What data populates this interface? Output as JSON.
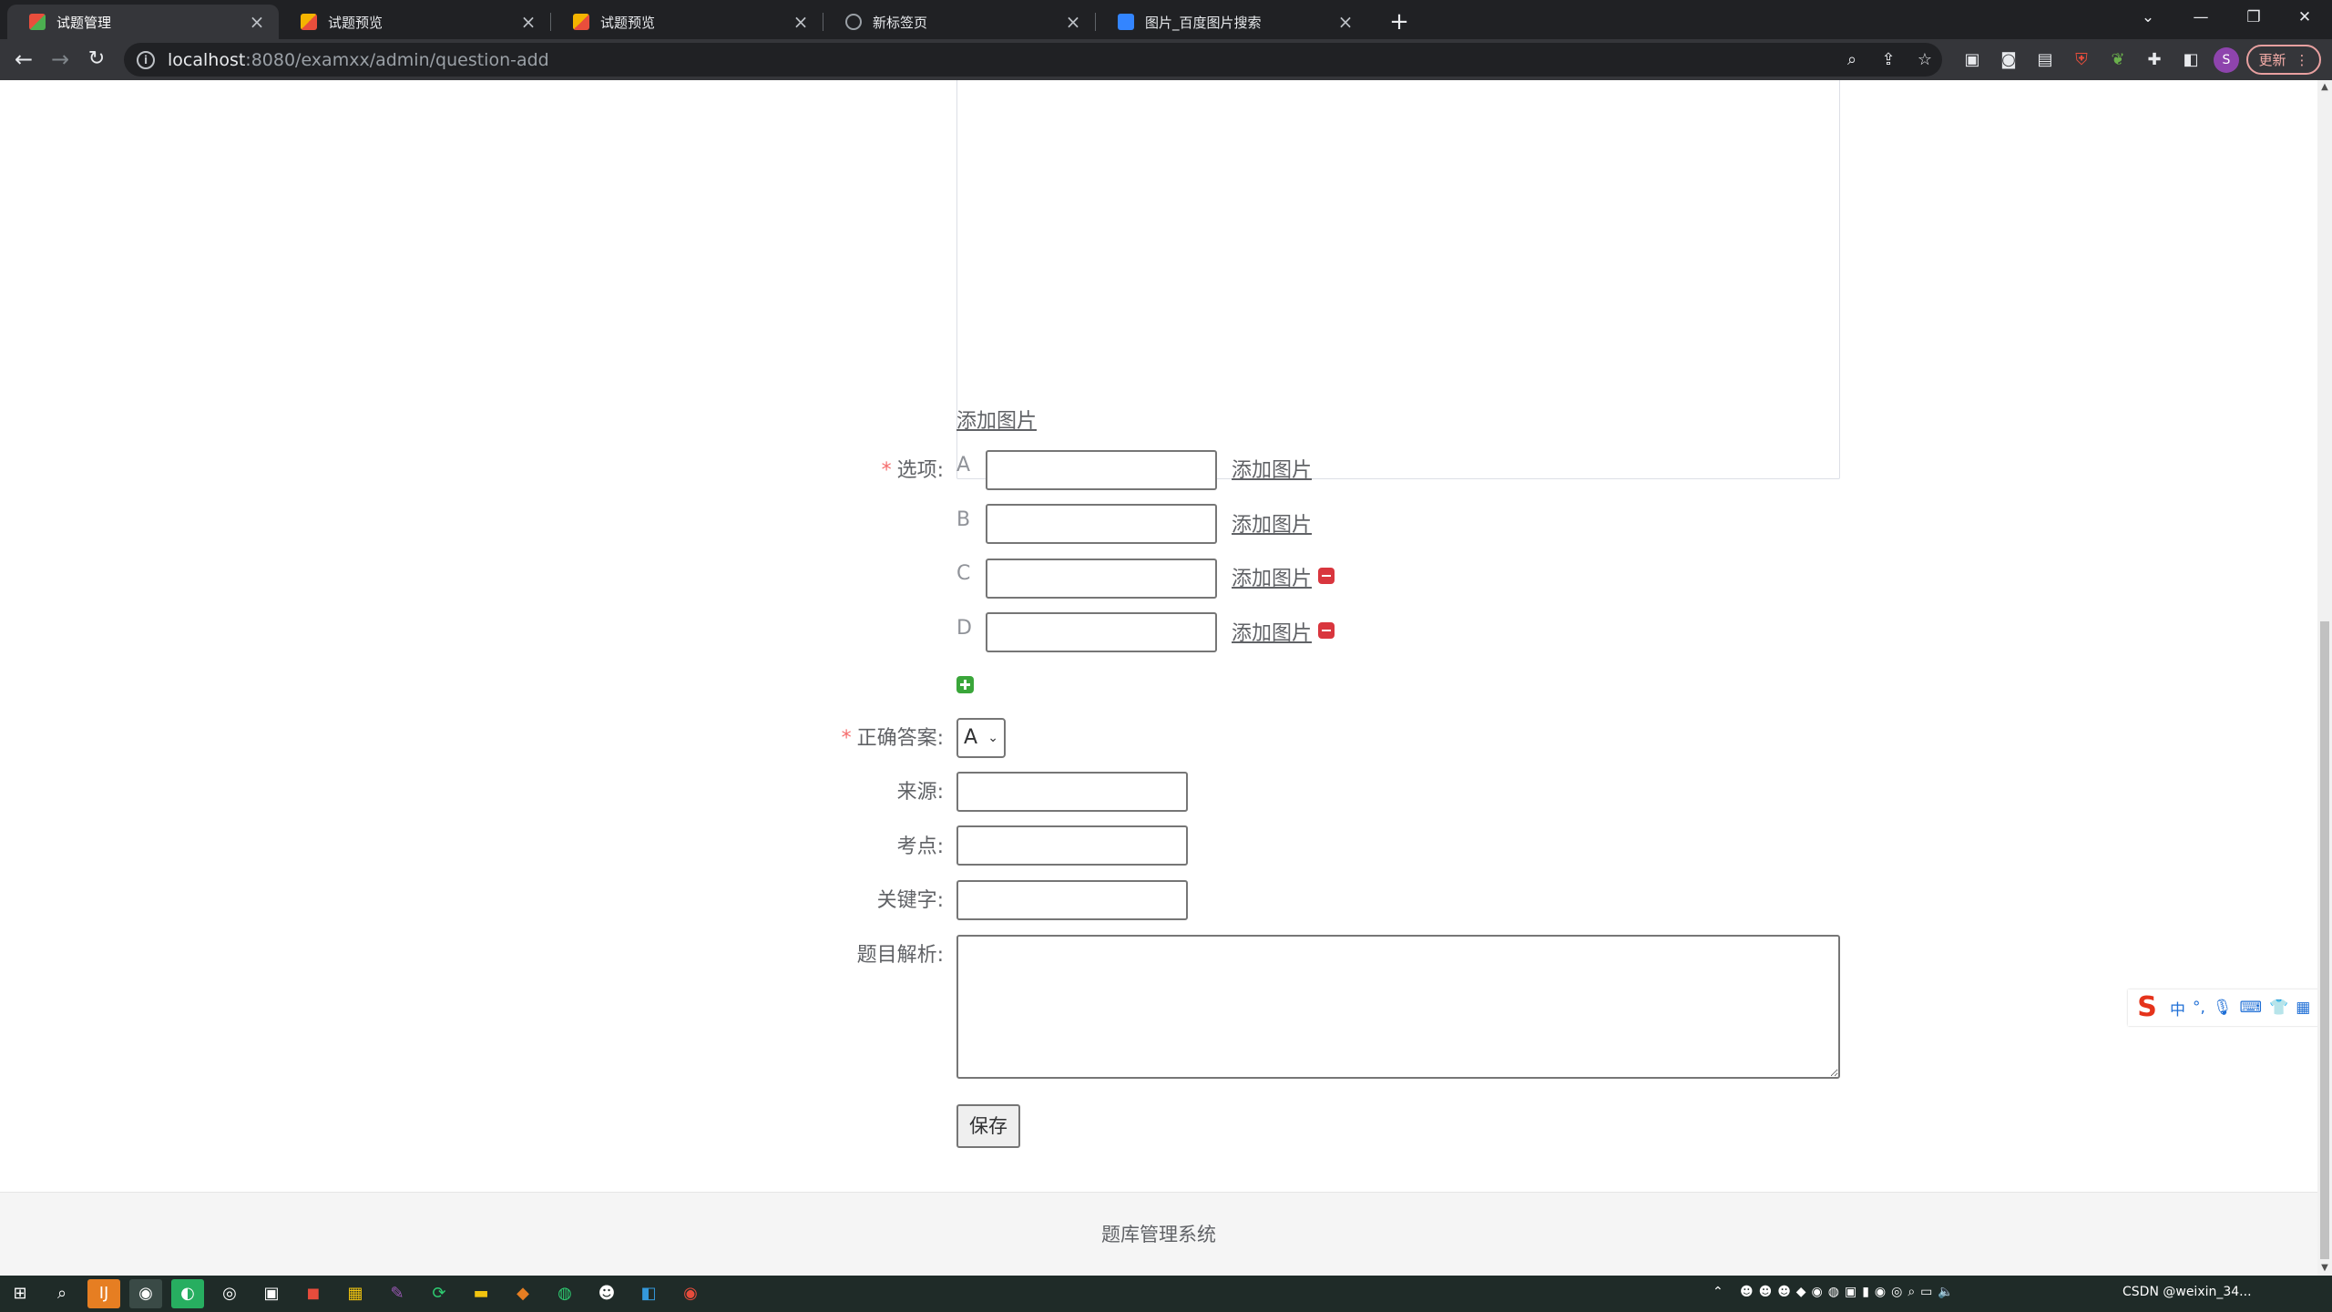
{
  "browser": {
    "tabs": [
      {
        "title": "试题管理",
        "active": true,
        "favicon_color": "#e94e3c"
      },
      {
        "title": "试题预览",
        "active": false,
        "favicon_color": "#f4b400"
      },
      {
        "title": "试题预览",
        "active": false,
        "favicon_color": "#f4b400"
      },
      {
        "title": "新标签页",
        "active": false,
        "favicon_color": "#9aa0a6"
      },
      {
        "title": "图片_百度图片搜索",
        "active": false,
        "favicon_color": "#3385ff"
      }
    ],
    "url_host": "localhost",
    "url_rest": ":8080/examxx/admin/question-add",
    "avatar_letter": "S",
    "update_label": "更新"
  },
  "form": {
    "add_image_label": "添加图片",
    "options_label": "选项:",
    "options": [
      {
        "letter": "A",
        "value": "",
        "removable": false
      },
      {
        "letter": "B",
        "value": "",
        "removable": false
      },
      {
        "letter": "C",
        "value": "",
        "removable": true
      },
      {
        "letter": "D",
        "value": "",
        "removable": true
      }
    ],
    "answer_label": "正确答案:",
    "answer_value": "A",
    "source_label": "来源:",
    "point_label": "考点:",
    "keyword_label": "关键字:",
    "analysis_label": "题目解析:",
    "save_label": "保存"
  },
  "footer": {
    "text": "题库管理系统"
  },
  "ime": {
    "logo": "S",
    "mode": "中",
    "punct": "°,"
  },
  "taskbar": {
    "tray_text": "CSDN @weixin_34..."
  },
  "colors": {
    "required": "#f56c6c",
    "remove": "#d9363e",
    "add": "#3aa63a"
  }
}
